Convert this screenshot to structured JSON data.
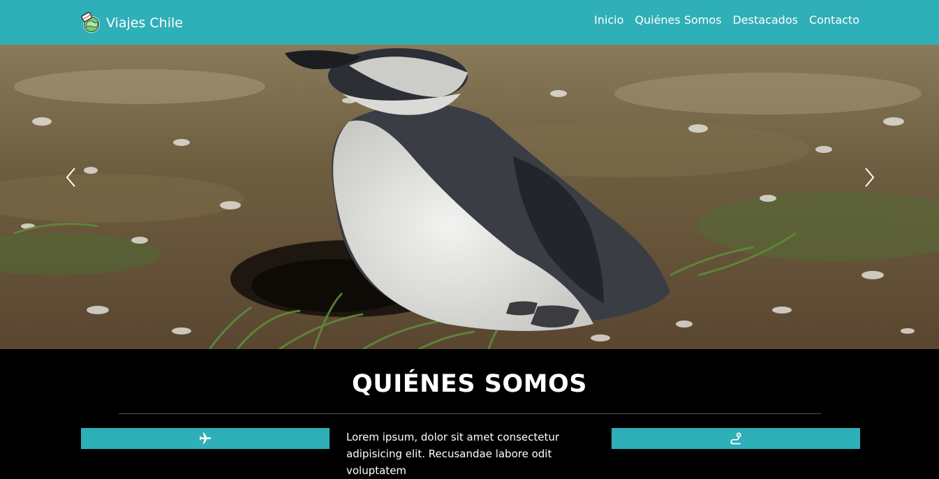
{
  "navbar": {
    "brand": "Viajes Chile",
    "brand_icon": "globe-travel-icon",
    "links": [
      {
        "label": "Inicio"
      },
      {
        "label": "Quiénes Somos"
      },
      {
        "label": "Destacados"
      },
      {
        "label": "Contacto"
      }
    ],
    "bg_color": "#2fafb7"
  },
  "hero": {
    "image": "penguin-photo",
    "prev_icon": "chevron-left-icon",
    "next_icon": "chevron-right-icon"
  },
  "about": {
    "title": "QUIÉNES SOMOS",
    "text": "Lorem ipsum, dolor sit amet consectetur adipisicing elit. Recusandae labore odit voluptatem",
    "left_icon": "airplane-icon",
    "right_icon": "route-icon",
    "accent_color": "#2fafb7"
  }
}
